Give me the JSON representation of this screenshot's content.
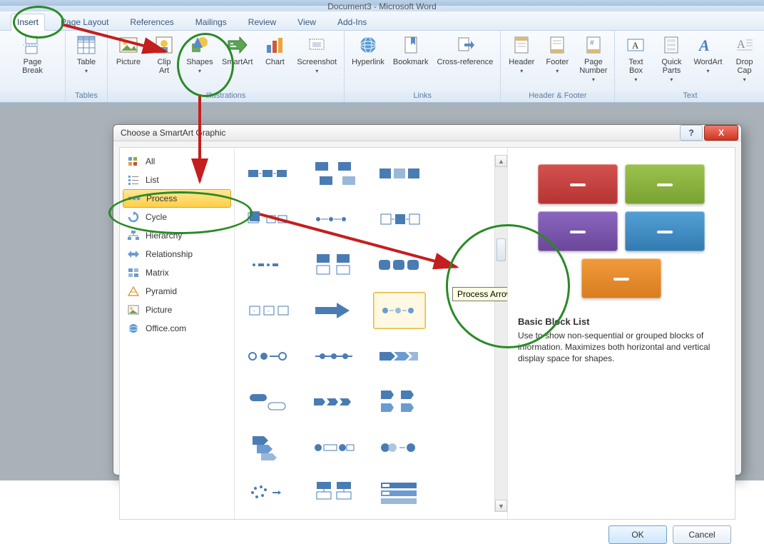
{
  "app_title": "Document3 - Microsoft Word",
  "tabs": {
    "insert": "Insert",
    "page_layout": "Page Layout",
    "references": "References",
    "mailings": "Mailings",
    "review": "Review",
    "view": "View",
    "addins": "Add-Ins"
  },
  "ribbon": {
    "page_break": "Page\nBreak",
    "table": "Table",
    "picture": "Picture",
    "clipart": "Clip\nArt",
    "shapes": "Shapes",
    "smartart": "SmartArt",
    "chart": "Chart",
    "screenshot": "Screenshot",
    "hyperlink": "Hyperlink",
    "bookmark": "Bookmark",
    "crossref": "Cross-reference",
    "header": "Header",
    "footer": "Footer",
    "pagenum": "Page\nNumber",
    "textbox": "Text\nBox",
    "quickparts": "Quick\nParts",
    "wordart": "WordArt",
    "dropcap": "Drop\nCap",
    "groups": {
      "tables": "Tables",
      "illustrations": "Illustrations",
      "links": "Links",
      "headerfooter": "Header & Footer",
      "text": "Text"
    }
  },
  "dialog": {
    "title": "Choose a SmartArt Graphic",
    "help": "?",
    "close": "X",
    "categories": {
      "all": "All",
      "list": "List",
      "process": "Process",
      "cycle": "Cycle",
      "hierarchy": "Hierarchy",
      "relationship": "Relationship",
      "matrix": "Matrix",
      "pyramid": "Pyramid",
      "picture": "Picture",
      "office": "Office.com"
    },
    "tooltip": "Process Arrows",
    "preview": {
      "title": "Basic Block List",
      "desc": "Use to show non-sequential or grouped blocks of information. Maximizes both horizontal and vertical display space for shapes.",
      "colors": [
        "#c73a3a",
        "#8bb33a",
        "#7a55b0",
        "#3a8fc7",
        "#e88b2a"
      ]
    },
    "ok": "OK",
    "cancel": "Cancel"
  }
}
